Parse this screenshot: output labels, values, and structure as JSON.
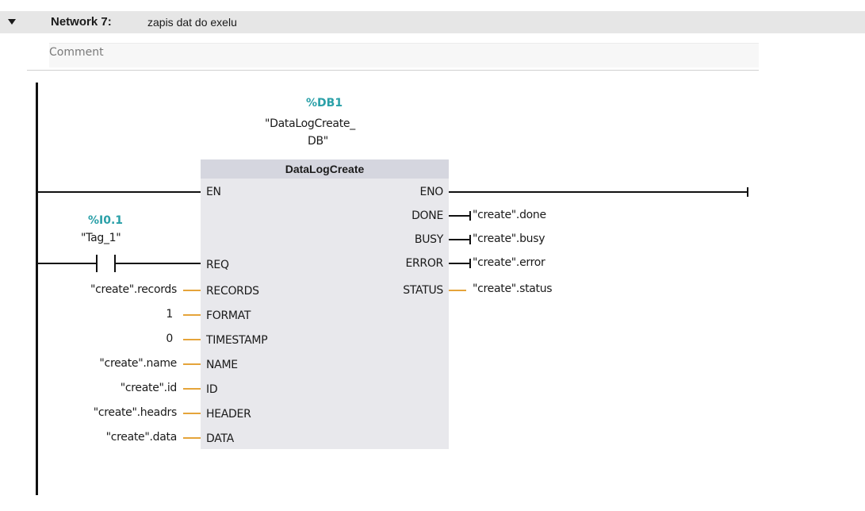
{
  "network": {
    "title": "Network 7:",
    "description": "zapis dat do exelu",
    "comment_placeholder": "Comment"
  },
  "instance": {
    "address": "%DB1",
    "name_line1": "\"DataLogCreate_",
    "name_line2": "DB\""
  },
  "block": {
    "name": "DataLogCreate",
    "inputs": {
      "en": "EN",
      "req": "REQ",
      "records": "RECORDS",
      "format": "FORMAT",
      "timestamp": "TIMESTAMP",
      "name": "NAME",
      "id": "ID",
      "header": "HEADER",
      "data": "DATA"
    },
    "outputs": {
      "eno": "ENO",
      "done": "DONE",
      "busy": "BUSY",
      "error": "ERROR",
      "status": "STATUS"
    }
  },
  "contact": {
    "address": "%I0.1",
    "tag": "\"Tag_1\""
  },
  "input_tags": {
    "records": "\"create\".records",
    "format": "1",
    "timestamp": "0",
    "name": "\"create\".name",
    "id": "\"create\".id",
    "header": "\"create\".headrs",
    "data": "\"create\".data"
  },
  "output_tags": {
    "done": "\"create\".done",
    "busy": "\"create\".busy",
    "error": "\"create\".error",
    "status": "\"create\".status"
  },
  "colors": {
    "address": "#2aa0a8",
    "wire_orange": "#e5a43a",
    "block_body": "#e8e8ec",
    "block_header": "#d5d6df"
  }
}
